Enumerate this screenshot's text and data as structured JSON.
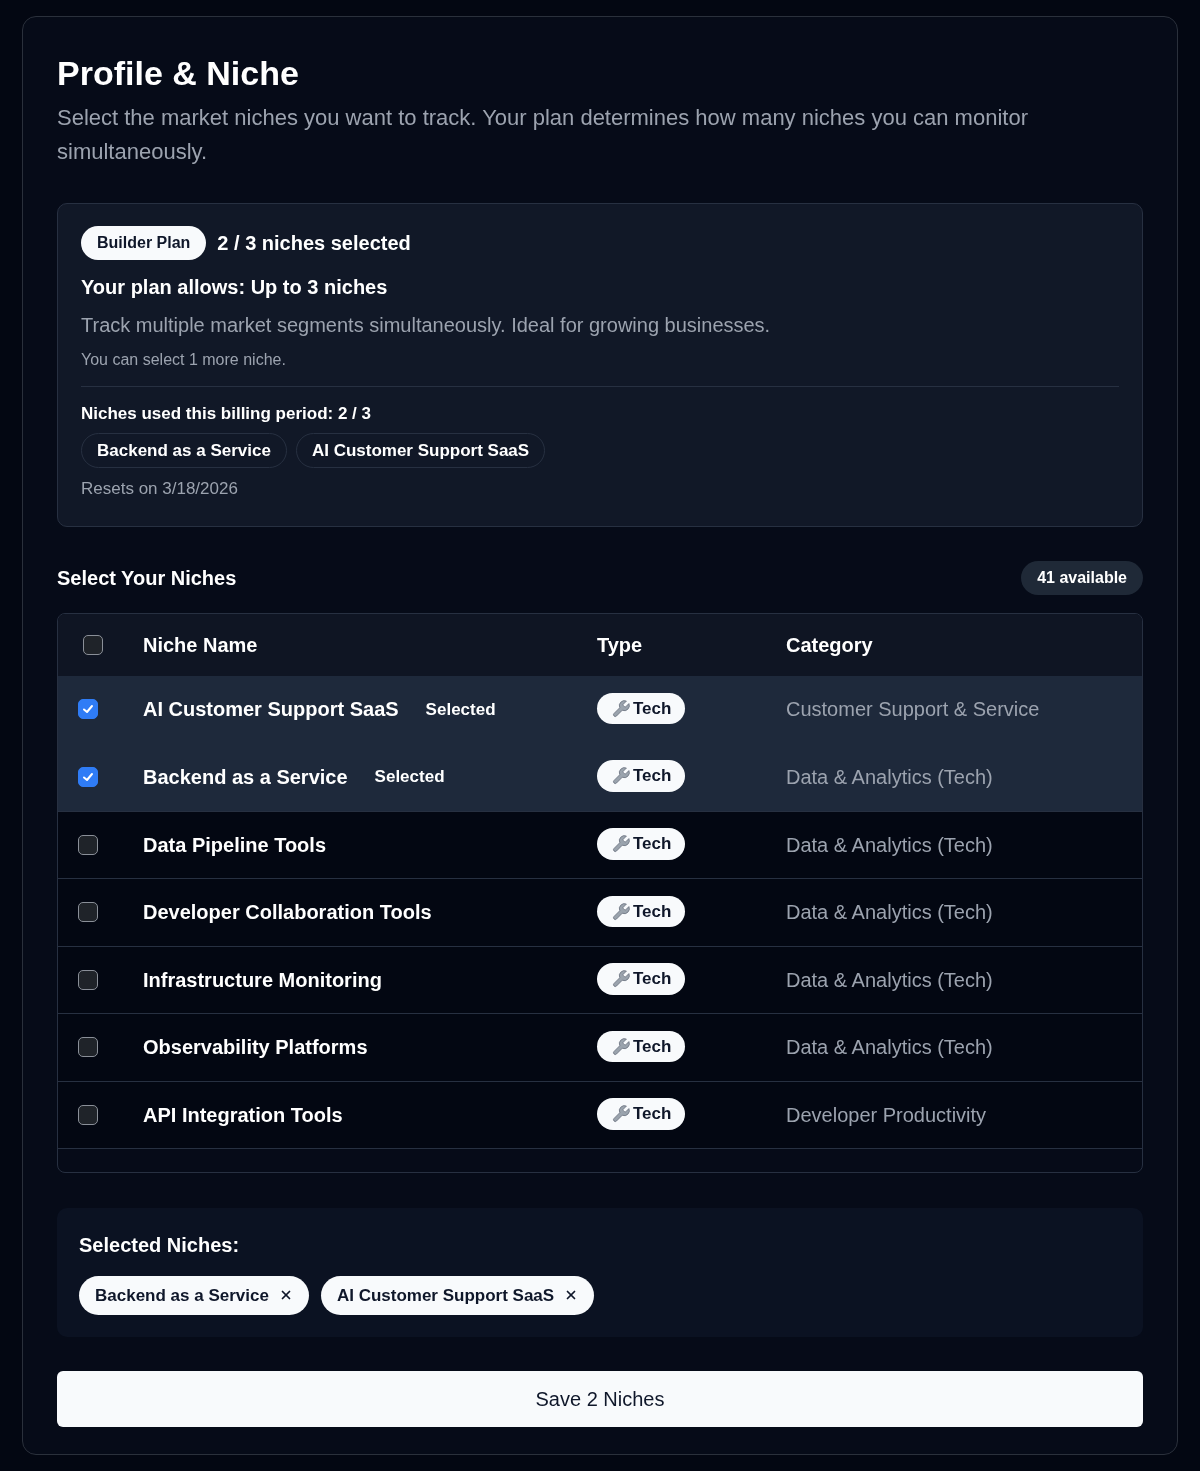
{
  "title": "Profile & Niche",
  "subtitle": "Select the market niches you want to track. Your plan determines how many niches you can monitor simultaneously.",
  "plan": {
    "badge": "Builder Plan",
    "count": "2 / 3 niches selected",
    "allows": "Your plan allows: Up to 3 niches",
    "description": "Track multiple market segments simultaneously. Ideal for growing businesses.",
    "remaining": "You can select 1 more niche.",
    "usage_label": "Niches used this billing period: 2 / 3",
    "used": [
      "Backend as a Service",
      "AI Customer Support SaaS"
    ],
    "resets": "Resets on 3/18/2026"
  },
  "section": {
    "title": "Select Your Niches",
    "available": "41 available"
  },
  "table": {
    "select_all_checked": false,
    "columns": [
      "Niche Name",
      "Type",
      "Category"
    ],
    "rows": [
      {
        "name": "AI Customer Support SaaS",
        "selected": true,
        "badge": "Selected",
        "type": "Tech",
        "category": "Customer Support & Service"
      },
      {
        "name": "Backend as a Service",
        "selected": true,
        "badge": "Selected",
        "type": "Tech",
        "category": "Data & Analytics (Tech)"
      },
      {
        "name": "Data Pipeline Tools",
        "selected": false,
        "type": "Tech",
        "category": "Data & Analytics (Tech)"
      },
      {
        "name": "Developer Collaboration Tools",
        "selected": false,
        "type": "Tech",
        "category": "Data & Analytics (Tech)"
      },
      {
        "name": "Infrastructure Monitoring",
        "selected": false,
        "type": "Tech",
        "category": "Data & Analytics (Tech)"
      },
      {
        "name": "Observability Platforms",
        "selected": false,
        "type": "Tech",
        "category": "Data & Analytics (Tech)"
      },
      {
        "name": "API Integration Tools",
        "selected": false,
        "type": "Tech",
        "category": "Developer Productivity"
      }
    ]
  },
  "selected_panel": {
    "title": "Selected Niches:",
    "chips": [
      "Backend as a Service",
      "AI Customer Support SaaS"
    ]
  },
  "save_button": "Save 2 Niches"
}
